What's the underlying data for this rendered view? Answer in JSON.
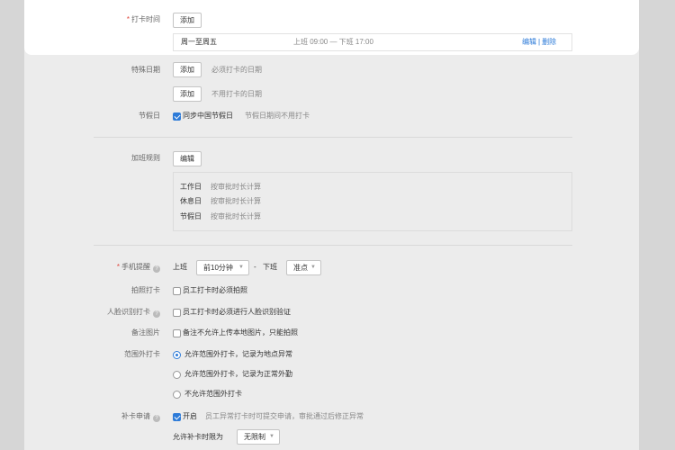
{
  "checkin_time": {
    "label": "打卡时间",
    "add_label": "添加",
    "schedule": {
      "days": "周一至周五",
      "hours": "上班 09:00 — 下班 17:00",
      "edit": "编辑",
      "sep": "|",
      "delete": "删除"
    }
  },
  "special_dates": {
    "label": "特殊日期",
    "rows": [
      {
        "button": "添加",
        "desc": "必须打卡的日期"
      },
      {
        "button": "添加",
        "desc": "不用打卡的日期"
      }
    ]
  },
  "holiday": {
    "label": "节假日",
    "checked": true,
    "option": "同步中国节假日",
    "desc": "节假日期间不用打卡"
  },
  "overtime": {
    "label": "加班规则",
    "edit_label": "编辑",
    "rules": [
      {
        "name": "工作日",
        "value": "按审批时长计算"
      },
      {
        "name": "休息日",
        "value": "按审批时长计算"
      },
      {
        "name": "节假日",
        "value": "按审批时长计算"
      }
    ]
  },
  "phone_reminder": {
    "label": "手机提醒",
    "work_label": "上班",
    "work_select": "前10分钟",
    "dash": "-",
    "off_label": "下班",
    "off_select": "准点"
  },
  "photo": {
    "label": "拍照打卡",
    "option": "员工打卡时必须拍照",
    "checked": false
  },
  "face": {
    "label": "人脸识别打卡",
    "option": "员工打卡时必须进行人脸识别验证",
    "checked": false
  },
  "remark_image": {
    "label": "备注图片",
    "option": "备注不允许上传本地图片，只能拍照",
    "checked": false
  },
  "out_of_range": {
    "label": "范围外打卡",
    "options": [
      {
        "text": "允许范围外打卡，记录为地点异常",
        "selected": true
      },
      {
        "text": "允许范围外打卡，记录为正常外勤",
        "selected": false
      },
      {
        "text": "不允许范围外打卡",
        "selected": false
      }
    ]
  },
  "makeup": {
    "label": "补卡申请",
    "checked": true,
    "option": "开启",
    "desc": "员工异常打卡时可提交申请，审批通过后修正异常",
    "limit_label": "允许补卡时限为",
    "limit_select": "无限制"
  },
  "icons": {
    "help": "question-circle-icon",
    "caret": "caret-down-icon"
  },
  "colors": {
    "accent": "#2d7bd8",
    "required": "#e0463c"
  }
}
